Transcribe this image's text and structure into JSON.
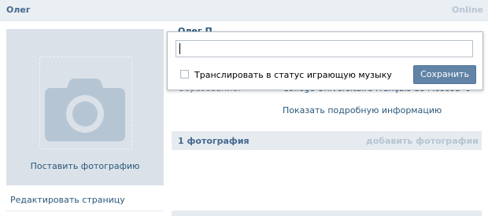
{
  "topbar": {
    "name": "Олег",
    "status": "Online"
  },
  "profile": {
    "name_partial": "Олег П"
  },
  "avatar": {
    "upload_label": "Поставить фотографию",
    "icon": "camera-icon"
  },
  "sidebar": {
    "edit_link": "Редактировать страницу"
  },
  "info": {
    "label": "Образование:",
    "value": "College Universitaire Français de Moscou '09",
    "show_more": "Показать подробную информацию"
  },
  "photos": {
    "title": "1 фотография",
    "add_link": "добавить фотографии"
  },
  "status_popup": {
    "input_value": "",
    "checkbox_label": "Транслировать в статус играющую музыку",
    "checkbox_checked": false,
    "save_label": "Сохранить"
  },
  "colors": {
    "link": "#2b587a",
    "header_bg": "#eaeff3",
    "button_bg": "#6083a6",
    "avatar_bg": "#dae1e8"
  }
}
